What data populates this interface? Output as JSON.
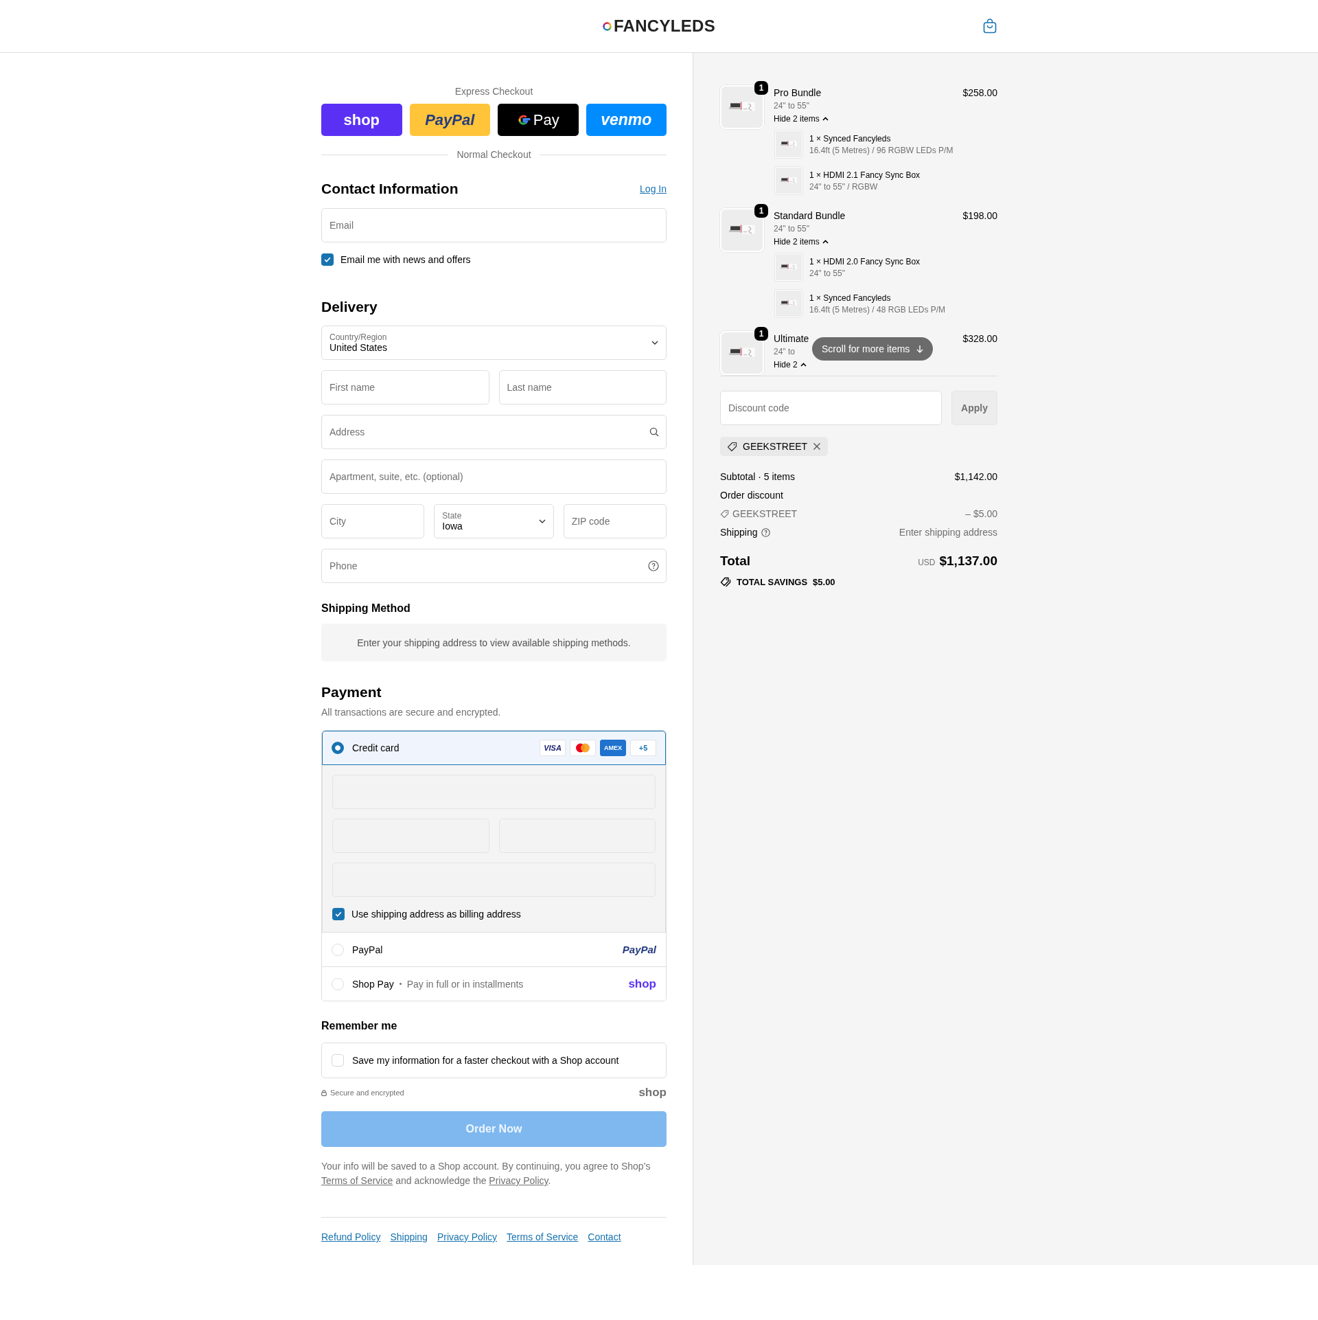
{
  "header": {
    "logo": "FANCYLEDS"
  },
  "express": {
    "label": "Express Checkout",
    "buttons": [
      {
        "kind": "shop",
        "label": "shop"
      },
      {
        "kind": "paypal",
        "label": "PayPal"
      },
      {
        "kind": "gpay",
        "label": "Pay"
      },
      {
        "kind": "venmo",
        "label": "venmo"
      }
    ],
    "divider_label": "Normal Checkout"
  },
  "contact": {
    "title": "Contact Information",
    "login": "Log In",
    "email": {
      "placeholder": "Email"
    },
    "newsletter": {
      "label": "Email me with news and offers",
      "checked": true
    }
  },
  "delivery": {
    "title": "Delivery",
    "rows": [
      {
        "fields": [
          {
            "kind": "select",
            "label": "Country/Region",
            "value": "United States"
          }
        ]
      },
      {
        "fields": [
          {
            "kind": "text",
            "placeholder": "First name"
          },
          {
            "kind": "text",
            "placeholder": "Last name"
          }
        ]
      },
      {
        "fields": [
          {
            "kind": "search",
            "placeholder": "Address"
          }
        ]
      },
      {
        "fields": [
          {
            "kind": "text",
            "placeholder": "Apartment, suite, etc. (optional)"
          }
        ]
      },
      {
        "fields": [
          {
            "kind": "text",
            "placeholder": "City"
          },
          {
            "kind": "select",
            "label": "State",
            "value": "Iowa"
          },
          {
            "kind": "text",
            "placeholder": "ZIP code"
          }
        ]
      },
      {
        "fields": [
          {
            "kind": "help",
            "placeholder": "Phone"
          }
        ]
      }
    ]
  },
  "shipping_method": {
    "title": "Shipping Method",
    "notice": "Enter your shipping address to view available shipping methods."
  },
  "payment": {
    "title": "Payment",
    "subtitle": "All transactions are secure and encrypted.",
    "methods": [
      {
        "kind": "card",
        "label": "Credit card",
        "selected": true,
        "badges": [
          {
            "kind": "visa",
            "label": "VISA"
          },
          {
            "kind": "mastercard"
          },
          {
            "kind": "amex",
            "label": "AMEX"
          },
          {
            "kind": "more",
            "label": "+5"
          }
        ],
        "billing": {
          "label": "Use shipping address as billing address",
          "checked": true
        }
      },
      {
        "kind": "paypal",
        "label": "PayPal",
        "selected": false,
        "logo": "PayPal"
      },
      {
        "kind": "shoppay",
        "label": "Shop Pay",
        "note": "Pay in full or in installments",
        "selected": false,
        "logo": "shop"
      }
    ]
  },
  "remember": {
    "title": "Remember me",
    "option": {
      "label": "Save my information for a faster checkout with a Shop account",
      "checked": false
    },
    "secure_note": "Secure and encrypted",
    "logo": "shop"
  },
  "order_button": {
    "label": "Order Now",
    "disabled": true
  },
  "legal": [
    {
      "kind": "text",
      "text": "Your info will be saved to a Shop account. By continuing, you agree to Shop’s "
    },
    {
      "kind": "link",
      "text": "Terms of Service"
    },
    {
      "kind": "text",
      "text": " and acknowledge the "
    },
    {
      "kind": "link",
      "text": "Privacy Policy"
    },
    {
      "kind": "text",
      "text": "."
    }
  ],
  "footer_links": [
    "Refund Policy",
    "Shipping",
    "Privacy Policy",
    "Terms of Service",
    "Contact"
  ],
  "cart": {
    "items": [
      {
        "quantity": "1",
        "title": "Pro Bundle",
        "variant": "24\" to 55\"",
        "toggle": "Hide 2 items",
        "expanded": true,
        "price": "$258.00",
        "components": [
          {
            "title": "1 × Synced Fancyleds",
            "variant": "16.4ft (5 Metres) / 96 RGBW LEDs P/M"
          },
          {
            "title": "1 × HDMI 2.1 Fancy Sync Box",
            "variant": "24\" to 55\" / RGBW"
          }
        ]
      },
      {
        "quantity": "1",
        "title": "Standard Bundle",
        "variant": "24\" to 55\"",
        "toggle": "Hide 2 items",
        "expanded": true,
        "price": "$198.00",
        "components": [
          {
            "title": "1 × HDMI 2.0 Fancy Sync Box",
            "variant": "24\" to 55\""
          },
          {
            "title": "1 × Synced Fancyleds",
            "variant": "16.4ft (5 Metres) / 48 RGB LEDs P/M"
          }
        ]
      },
      {
        "quantity": "1",
        "title": "Ultimate",
        "variant": "24\" to",
        "toggle": "Hide 2",
        "expanded": true,
        "price": "$328.00"
      }
    ],
    "scroll_hint": "Scroll for more items"
  },
  "discount": {
    "placeholder": "Discount code",
    "apply": "Apply",
    "applied_code": "GEEKSTREET"
  },
  "summary": {
    "lines": [
      {
        "kind": "subtotal",
        "label": "Subtotal · 5 items",
        "value": "$1,142.00"
      },
      {
        "kind": "heading",
        "label": "Order discount"
      },
      {
        "kind": "discount",
        "label": "GEEKSTREET",
        "value": "– $5.00"
      },
      {
        "kind": "shipping",
        "label": "Shipping",
        "value": "Enter shipping address"
      }
    ],
    "total": {
      "label": "Total",
      "currency": "USD",
      "value": "$1,137.00"
    },
    "savings": {
      "label": "TOTAL SAVINGS",
      "value": "$5.00"
    }
  }
}
